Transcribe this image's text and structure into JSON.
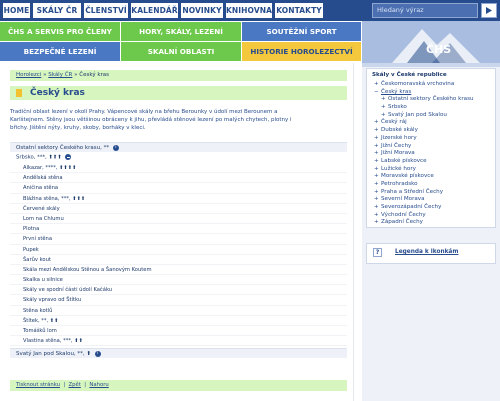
{
  "topnav": {
    "items": [
      "HOME",
      "SKÁLY ČR",
      "ČLENSTVÍ",
      "KALENDÁŘ",
      "NOVINKY",
      "KNIHOVNA",
      "KONTAKTY"
    ],
    "search_placeholder": "Hledaný výraz"
  },
  "categories": {
    "row1": [
      "ČHS A SERVIS PRO ČLENY",
      "HORY, SKÁLY, LEZENÍ",
      "SOUTĚŽNÍ SPORT"
    ],
    "row2": [
      "BEZPEČNÉ LEZENÍ",
      "SKALNÍ OBLASTI",
      "HISTORIE HOROLEZECTVÍ"
    ]
  },
  "logo_text": "ČHS",
  "breadcrumb": {
    "home": "Horolezci",
    "sep1": "»",
    "parent": "Skály ČR",
    "sep2": "»",
    "current": "Český kras"
  },
  "page_title": "Český kras",
  "intro_lines": [
    "Tradiční oblast lezení v okolí Prahy. Vápencové skály na břehu Berounky v údolí mezi Berounem a",
    "Karlštejnem. Stěny jsou většinou obráceny k jihu, převládá stěnové lezení po malých chytech, plotny i",
    "břichy. Jištění nýty, kruhy, skoby, borháky v kleci."
  ],
  "sectors": {
    "other_label": "Ostatní sektory Českého krasu, **",
    "srbsko_label": "Srbsko, ***, ⬆⬆⬆",
    "crags": [
      "Alkazar, ****, ⬆⬆⬆⬆",
      "Andělská stěna",
      "Aničina stěna",
      "Blážina stěna, ***, ⬆⬆⬆",
      "Červené skály",
      "Lom na Chlumu",
      "Plotna",
      "První stěna",
      "Pupek",
      "Šarův kout",
      "Skála mezi Andělskou Stěnou a Šanovým Koutem",
      "Skalka u silnice",
      "Skály ve spodní části údolí Kačáku",
      "Skály vpravo od Štítku",
      "Stěna kotlů",
      "Štítek, **, ⬆⬆",
      "Tomášků lom",
      "Vlastina stěna, ***, ⬆⬆"
    ],
    "svaty_jan_label": "Svatý Jan pod Skalou, **, ⬆"
  },
  "footer": {
    "print": "Tisknout stránku",
    "sep1": "|",
    "back": "Zpět",
    "sep2": "|",
    "top": "Nahoru"
  },
  "sidebar": {
    "title": "Skály v České republice",
    "items": [
      {
        "label": "Českomoravská vrchovina",
        "sub": false
      },
      {
        "label": "Český kras",
        "sub": false
      },
      {
        "label": "Ostatní sektory Českého krasu",
        "sub": true
      },
      {
        "label": "Srbsko",
        "sub": true
      },
      {
        "label": "Svatý Jan pod Skalou",
        "sub": true
      },
      {
        "label": "Český ráj",
        "sub": false
      },
      {
        "label": "Dubské skály",
        "sub": false
      },
      {
        "label": "Jizerské hory",
        "sub": false
      },
      {
        "label": "Jižní Čechy",
        "sub": false
      },
      {
        "label": "Jižní Morava",
        "sub": false
      },
      {
        "label": "Labské pískovce",
        "sub": false
      },
      {
        "label": "Lužické hory",
        "sub": false
      },
      {
        "label": "Moravské pískovce",
        "sub": false
      },
      {
        "label": "Petrohradsko",
        "sub": false
      },
      {
        "label": "Praha a Střední Čechy",
        "sub": false
      },
      {
        "label": "Severní Morava",
        "sub": false
      },
      {
        "label": "Severozápadní Čechy",
        "sub": false
      },
      {
        "label": "Východní Čechy",
        "sub": false
      },
      {
        "label": "Západní Čechy",
        "sub": false
      }
    ],
    "legend_q": "?",
    "legend_link": "Legenda k ikonkám"
  },
  "colors": {
    "nav": "#274c8d",
    "cat_green": "#6dc94b",
    "cat_blue": "#4b78c3",
    "cat_yellow": "#f3c83c",
    "highlight_green": "#d6f5bf"
  }
}
